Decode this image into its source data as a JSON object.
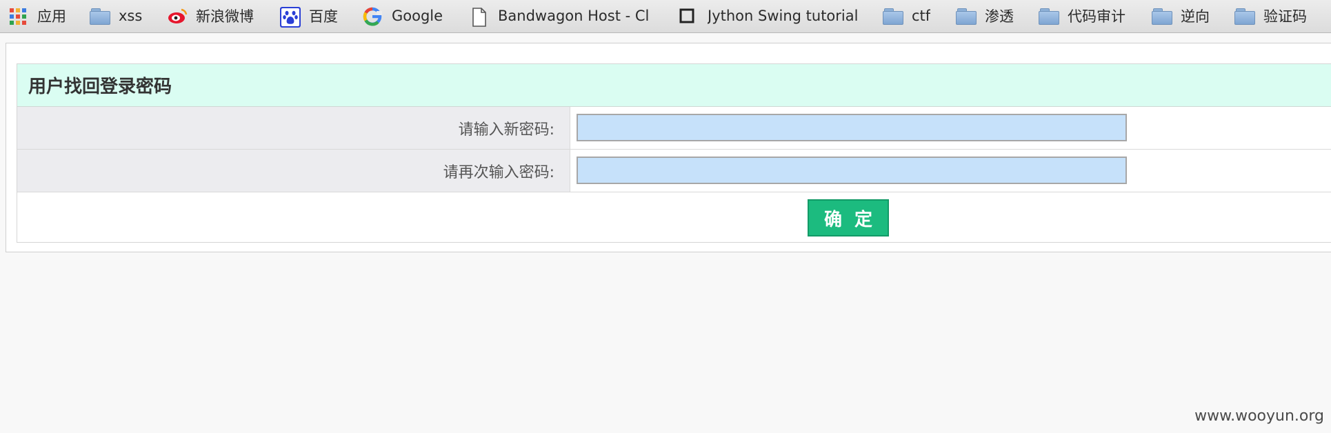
{
  "bookmarks": [
    {
      "label": "应用",
      "icon": "apps-grid-icon"
    },
    {
      "label": "xss",
      "icon": "folder-icon"
    },
    {
      "label": "新浪微博",
      "icon": "weibo-icon"
    },
    {
      "label": "百度",
      "icon": "baidu-paw-icon"
    },
    {
      "label": "Google",
      "icon": "google-icon"
    },
    {
      "label": "Bandwagon Host - Cl",
      "icon": "page-icon"
    },
    {
      "label": "Jython Swing tutorial",
      "icon": "square-icon"
    },
    {
      "label": "ctf",
      "icon": "folder-icon"
    },
    {
      "label": "渗透",
      "icon": "folder-icon"
    },
    {
      "label": "代码审计",
      "icon": "folder-icon"
    },
    {
      "label": "逆向",
      "icon": "folder-icon"
    },
    {
      "label": "验证码",
      "icon": "folder-icon"
    }
  ],
  "form": {
    "title": "用户找回登录密码",
    "new_password_label": "请输入新密码:",
    "confirm_password_label": "请再次输入密码:",
    "new_password_value": "",
    "confirm_password_value": "",
    "submit_label": "确定"
  },
  "watermark": "www.wooyun.org",
  "colors": {
    "title_bg": "#dafdf2",
    "label_bg": "#ececef",
    "input_bg": "#c6e1fa",
    "button_bg": "#1cbb7f"
  }
}
